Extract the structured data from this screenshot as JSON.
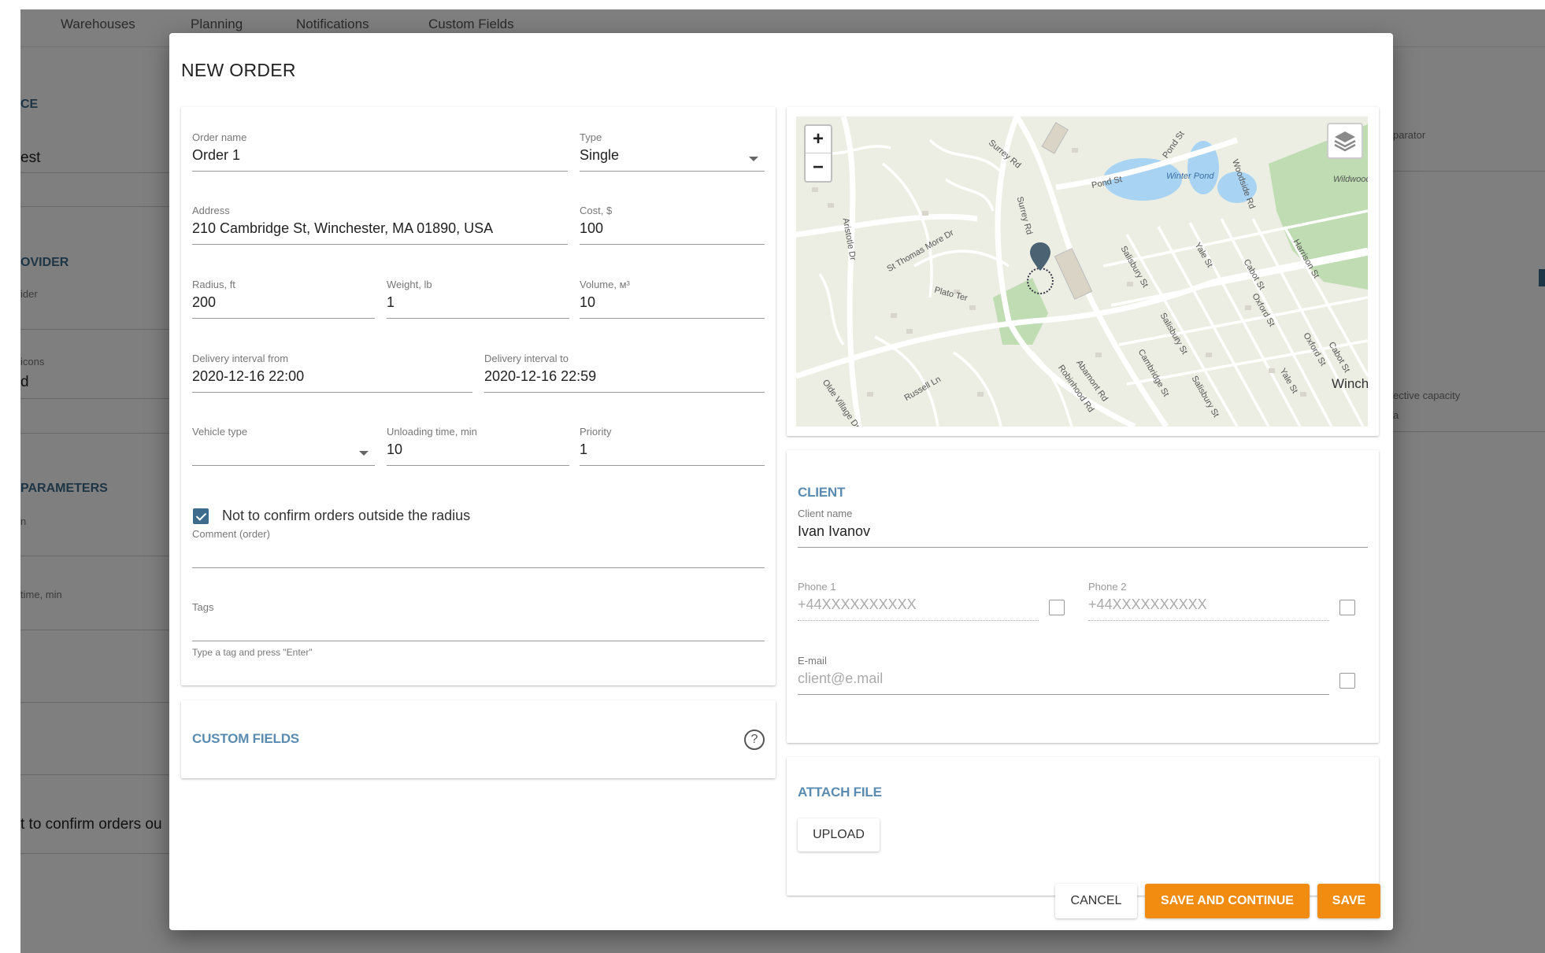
{
  "background": {
    "tabs": [
      "Warehouses",
      "Planning",
      "Notifications",
      "Custom Fields"
    ],
    "left_sections": [
      "CE",
      "OVIDER",
      "PARAMETERS"
    ],
    "left_labels": [
      "ider",
      "icons",
      "n",
      "time, min"
    ],
    "left_values": [
      "est",
      "d"
    ],
    "left_text": "t to confirm orders ou",
    "right_labels": [
      "parator",
      "ective capacity"
    ],
    "right_values": [
      "a"
    ]
  },
  "modal": {
    "title": "NEW ORDER",
    "order": {
      "order_name": {
        "label": "Order name",
        "value": "Order 1"
      },
      "type": {
        "label": "Type",
        "value": "Single"
      },
      "address": {
        "label": "Address",
        "value": "210 Cambridge St, Winchester, MA 01890, USA"
      },
      "cost": {
        "label": "Cost, $",
        "value": "100"
      },
      "radius": {
        "label": "Radius, ft",
        "value": "200"
      },
      "weight": {
        "label": "Weight, lb",
        "value": "1"
      },
      "volume": {
        "label": "Volume, м³",
        "value": "10"
      },
      "delivery_from": {
        "label": "Delivery interval from",
        "value": "2020-12-16 22:00"
      },
      "delivery_to": {
        "label": "Delivery interval to",
        "value": "2020-12-16 22:59"
      },
      "vehicle_type": {
        "label": "Vehicle type",
        "value": ""
      },
      "unloading_time": {
        "label": "Unloading time, min",
        "value": "10"
      },
      "priority": {
        "label": "Priority",
        "value": "1"
      },
      "confirm_checkbox": {
        "label": "Not to confirm orders outside the radius",
        "checked": true
      },
      "comment": {
        "label": "Comment (order)",
        "value": ""
      },
      "tags": {
        "label": "Tags",
        "value": "",
        "hint": "Type a tag and press \"Enter\""
      }
    },
    "custom_fields": {
      "title": "CUSTOM FIELDS",
      "help_icon": "help-circle-icon"
    },
    "map": {
      "zoom_in": "+",
      "zoom_out": "−",
      "layers_icon": "layers-icon",
      "marker_icon": "map-pin-icon",
      "labels": [
        "Surrey Rd",
        "Pond St",
        "Pond St",
        "Winter Pond",
        "Wildwood",
        "Woodside Rd",
        "Aristotle Dr",
        "St Thomas More Dr",
        "Plato Ter",
        "Surrey Rd",
        "Salisbury St",
        "Yale St",
        "Cabot St",
        "Harrison St",
        "Oxford St",
        "Salisbury St",
        "Cambridge St",
        "Abamont Rd",
        "Robinhood Rd",
        "Russell Ln",
        "Olde Village Dr",
        "Yale St",
        "Oxford St",
        "Cabot St",
        "Salisbury St",
        "Winch"
      ]
    },
    "client": {
      "title": "CLIENT",
      "name": {
        "label": "Client name",
        "value": "Ivan Ivanov"
      },
      "phone1": {
        "label": "Phone 1",
        "placeholder": "+44XXXXXXXXXX"
      },
      "phone2": {
        "label": "Phone 2",
        "placeholder": "+44XXXXXXXXXX"
      },
      "email": {
        "label": "E-mail",
        "placeholder": "client@e.mail"
      }
    },
    "attach": {
      "title": "ATTACH FILE",
      "upload_label": "UPLOAD"
    },
    "actions": {
      "cancel": "CANCEL",
      "save_continue": "SAVE AND CONTINUE",
      "save": "SAVE"
    },
    "colors": {
      "accent": "#f28c10",
      "section": "#5a8bb0",
      "checkbox": "#3d6b8c",
      "water": "#a9d3f2",
      "park": "#bfdcb2"
    }
  }
}
